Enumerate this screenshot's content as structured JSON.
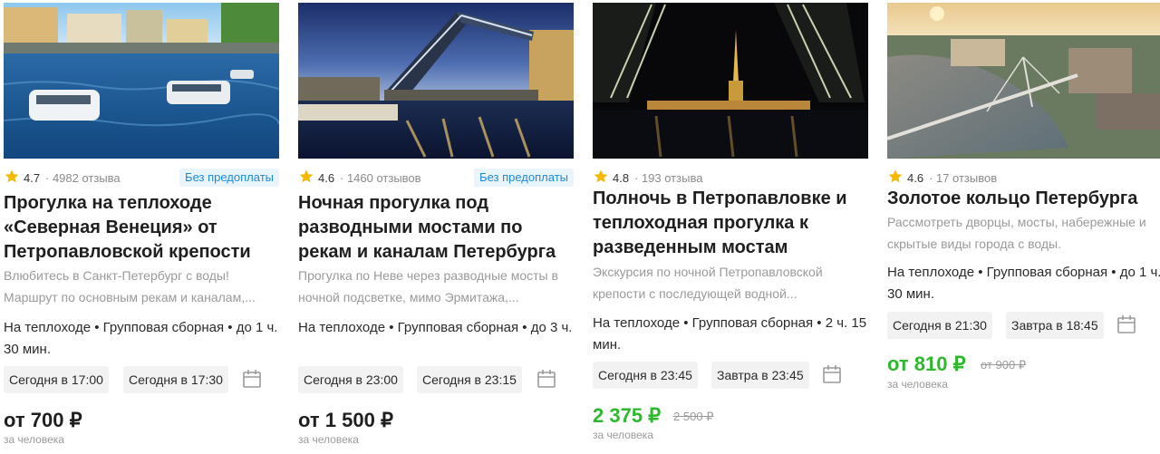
{
  "cards": [
    {
      "rating": "4.7",
      "reviews": "· 4982 отзыва",
      "badge": "Без предоплаты",
      "title": "Прогулка на теплоходе «Северная Венеция» от Петропавловской крепости",
      "description": "Влюбитесь в Санкт-Петербург с воды! Маршрут по основным рекам и каналам,...",
      "meta": "На теплоходе • Групповая сборная • до 1 ч. 30 мин.",
      "times": [
        "Сегодня в 17:00",
        "Сегодня в 17:30"
      ],
      "price": "от 700 ₽",
      "old_price": "",
      "per_person": "за человека"
    },
    {
      "rating": "4.6",
      "reviews": "· 1460 отзывов",
      "badge": "Без предоплаты",
      "title": "Ночная прогулка под разводными мостами по рекам и каналам Петербурга",
      "description": "Прогулка по Неве через разводные мосты в ночной подсветке, мимо Эрмитажа,...",
      "meta": "На теплоходе • Групповая сборная • до 3 ч.",
      "times": [
        "Сегодня в 23:00",
        "Сегодня в 23:15"
      ],
      "price": "от 1 500 ₽",
      "old_price": "",
      "per_person": "за человека"
    },
    {
      "rating": "4.8",
      "reviews": "· 193 отзыва",
      "badge": "",
      "title": "Полночь в Петропавловке и теплоходная прогулка к разведенным мостам",
      "description": "Экскурсия по ночной Петропавловской крепости с последующей водной...",
      "meta": "На теплоходе • Групповая сборная • 2 ч. 15 мин.",
      "times": [
        "Сегодня в 23:45",
        "Завтра в 23:45"
      ],
      "price": "2 375 ₽",
      "old_price": "2 500 ₽",
      "per_person": "за человека"
    },
    {
      "rating": "4.6",
      "reviews": "· 17 отзывов",
      "badge": "",
      "title": "Золотое кольцо Петербурга",
      "description": "Рассмотреть дворцы, мосты, набережные и скрытые виды города с воды.",
      "meta": "На теплоходе • Групповая сборная • до 1 ч. 30 мин.",
      "times": [
        "Сегодня в 21:30",
        "Завтра в 18:45"
      ],
      "price": "от 810 ₽",
      "old_price": "от 900 ₽",
      "per_person": "за человека"
    }
  ],
  "icons": {
    "rating": "star-icon",
    "schedule": "calendar-icon"
  },
  "colors": {
    "star": "#f5b800",
    "badge_text": "#1b8ad6",
    "badge_bg": "#eaf4fb",
    "discount_price": "#2db82d"
  }
}
